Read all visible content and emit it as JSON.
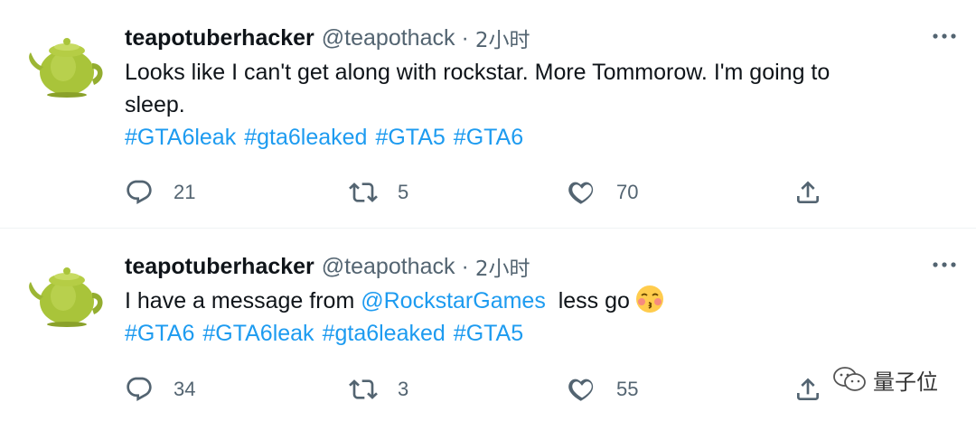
{
  "tweets": [
    {
      "username": "teapotuberhacker",
      "handle": "@teapothack",
      "separator": "·",
      "time": "2小时",
      "text_lines": [
        "Looks like I can't get along with rockstar. More Tommorow. I'm going to",
        "sleep."
      ],
      "hashtags": [
        "#GTA6leak",
        "#gta6leaked",
        "#GTA5",
        "#GTA6"
      ],
      "replies": "21",
      "retweets": "5",
      "likes": "70"
    },
    {
      "username": "teapotuberhacker",
      "handle": "@teapothack",
      "separator": "·",
      "time": "2小时",
      "text_before": "I have a message from ",
      "mention": "@RockstarGames",
      "text_after": "  less go",
      "emoji": "kissing-face-emoji",
      "hashtags": [
        "#GTA6",
        "#GTA6leak",
        "#gta6leaked",
        "#GTA5"
      ],
      "replies": "34",
      "retweets": "3",
      "likes": "55"
    }
  ],
  "watermark": {
    "text": "量子位"
  },
  "colors": {
    "link": "#1d9bf0",
    "secondary": "#536471",
    "text": "#0f1419",
    "avatar_teapot": "#a8c23c"
  }
}
